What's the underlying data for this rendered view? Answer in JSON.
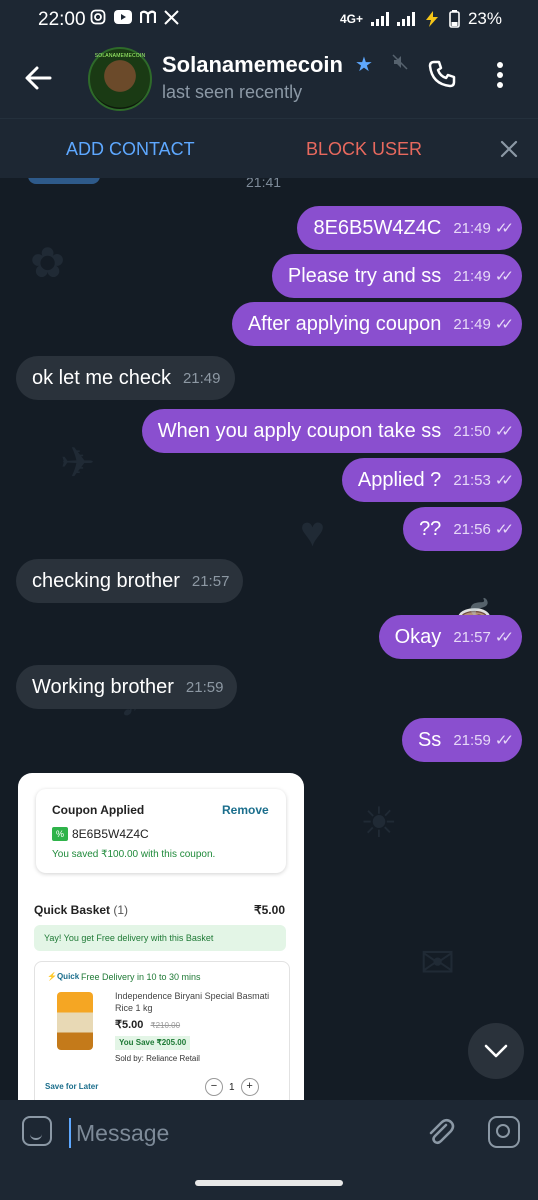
{
  "statusbar": {
    "time": "22:00",
    "network": "4G+",
    "battery": "23%",
    "app_icons": [
      "instagram-icon",
      "youtube-icon",
      "m-icon",
      "x-icon"
    ]
  },
  "header": {
    "name": "Solanamemecoin",
    "status": "last seen recently",
    "avatar_text": "SOLANAMEMECOIN",
    "verified_icon": "star-icon",
    "accent": "#5ea8ff"
  },
  "actions": {
    "add_contact": "ADD CONTACT",
    "block_user": "BLOCK USER"
  },
  "chat": {
    "previous_time": "21:41",
    "messages": [
      {
        "text": "8E6B5W4Z4C",
        "time": "21:49",
        "direction": "out"
      },
      {
        "text": "Please try and ss",
        "time": "21:49",
        "direction": "out"
      },
      {
        "text": "After applying coupon",
        "time": "21:49",
        "direction": "out"
      },
      {
        "text": "ok let me check",
        "time": "21:49",
        "direction": "in"
      },
      {
        "text": "When you apply coupon take ss",
        "time": "21:50",
        "direction": "out"
      },
      {
        "text": "Applied ?",
        "time": "21:53",
        "direction": "out"
      },
      {
        "text": "??",
        "time": "21:56",
        "direction": "out"
      },
      {
        "text": "checking brother",
        "time": "21:57",
        "direction": "in"
      },
      {
        "text": "Okay",
        "time": "21:57",
        "direction": "out"
      },
      {
        "text": "Working brother",
        "time": "21:59",
        "direction": "in"
      },
      {
        "text": "Ss",
        "time": "21:59",
        "direction": "out"
      }
    ],
    "ticks": "✓✓",
    "outgoing_color": "#8a4fcf",
    "incoming_color": "#2a323b"
  },
  "screenshot": {
    "coupon_title": "Coupon Applied",
    "remove_label": "Remove",
    "coupon_code": "8E6B5W4Z4C",
    "saved_text": "You saved ₹100.00 with this coupon.",
    "basket_title": "Quick Basket",
    "basket_count": "(1)",
    "basket_price": "₹5.00",
    "free_delivery": "Yay! You get Free delivery with this Basket",
    "quick_label": "⚡Quick",
    "delivery_text": "Free Delivery in 10 to 30 mins",
    "product_name": "Independence Biryani Special Basmati Rice 1 kg",
    "product_price": "₹5.00",
    "product_mrp": "₹210.00",
    "product_save": "You Save ₹205.00",
    "sold_by": "Sold by: Reliance Retail",
    "save_later": "Save for Later",
    "qty": "1",
    "minus": "−",
    "plus": "+"
  },
  "input": {
    "placeholder": "Message"
  }
}
